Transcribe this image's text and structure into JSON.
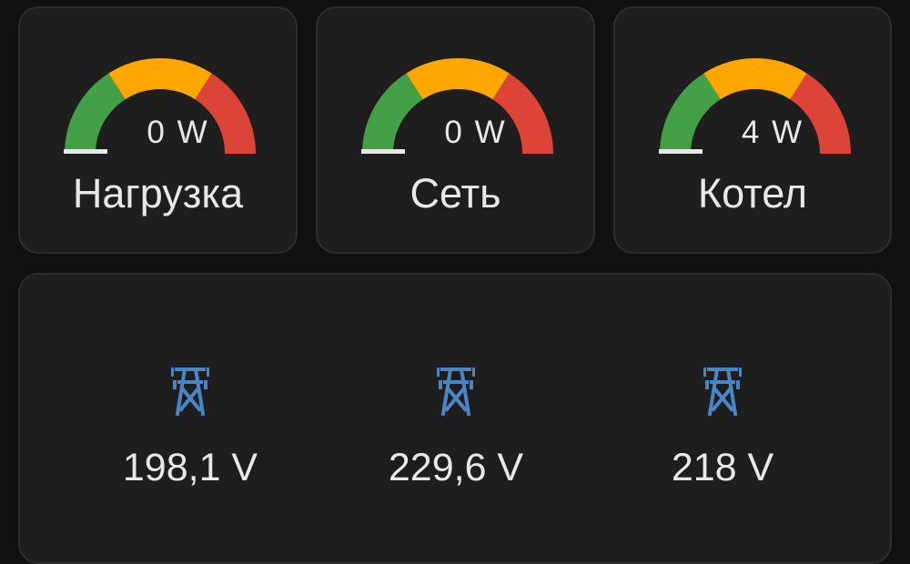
{
  "colors": {
    "background": "#111111",
    "card": "#1e1e1e",
    "gauge_green": "#43a047",
    "gauge_yellow": "#ffa600",
    "gauge_red": "#db4437",
    "icon_blue": "#4a86c5"
  },
  "gauges": [
    {
      "value_text": "0 W",
      "name": "Нагрузка",
      "level": 0.0
    },
    {
      "value_text": "0 W",
      "name": "Сеть",
      "level": 0.0
    },
    {
      "value_text": "4 W",
      "name": "Котел",
      "level": 0.005
    }
  ],
  "voltage": {
    "icon": "transmission-tower-icon",
    "items": [
      {
        "value": "198,1 V"
      },
      {
        "value": "229,6 V"
      },
      {
        "value": "218 V"
      }
    ]
  }
}
